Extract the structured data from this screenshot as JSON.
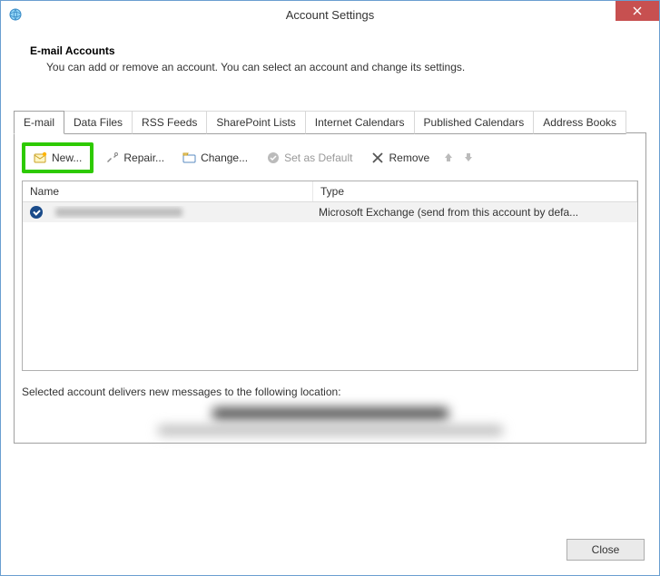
{
  "window": {
    "title": "Account Settings"
  },
  "header": {
    "title": "E-mail Accounts",
    "description": "You can add or remove an account. You can select an account and change its settings."
  },
  "tabs": [
    {
      "label": "E-mail",
      "active": true
    },
    {
      "label": "Data Files",
      "active": false
    },
    {
      "label": "RSS Feeds",
      "active": false
    },
    {
      "label": "SharePoint Lists",
      "active": false
    },
    {
      "label": "Internet Calendars",
      "active": false
    },
    {
      "label": "Published Calendars",
      "active": false
    },
    {
      "label": "Address Books",
      "active": false
    }
  ],
  "toolbar": {
    "new_label": "New...",
    "repair_label": "Repair...",
    "change_label": "Change...",
    "set_default_label": "Set as Default",
    "remove_label": "Remove"
  },
  "columns": {
    "name": "Name",
    "type": "Type"
  },
  "accounts": [
    {
      "name_redacted": true,
      "type": "Microsoft Exchange (send from this account by defa..."
    }
  ],
  "footer": {
    "delivery_text": "Selected account delivers new messages to the following location:"
  },
  "buttons": {
    "close": "Close"
  }
}
